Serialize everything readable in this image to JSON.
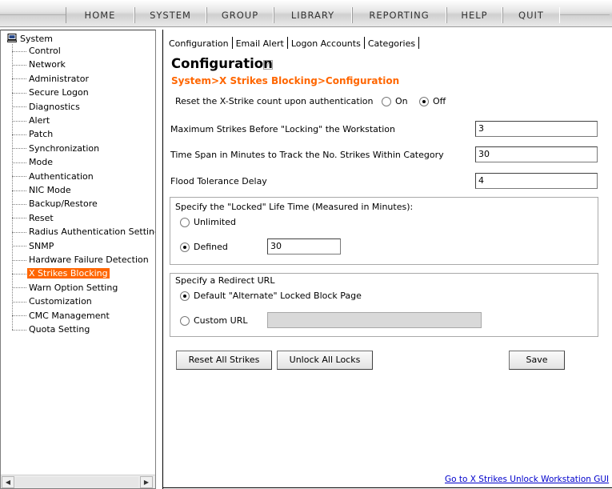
{
  "topnav": {
    "items": [
      "HOME",
      "SYSTEM",
      "GROUP",
      "LIBRARY",
      "REPORTING",
      "HELP",
      "QUIT"
    ]
  },
  "tree": {
    "root_label": "System",
    "root_icon": "computer-icon",
    "items": [
      "Control",
      "Network",
      "Administrator",
      "Secure Logon",
      "Diagnostics",
      "Alert",
      "Patch",
      "Synchronization",
      "Mode",
      "Authentication",
      "NIC Mode",
      "Backup/Restore",
      "Reset",
      "Radius Authentication Setting",
      "SNMP",
      "Hardware Failure Detection",
      "X Strikes Blocking",
      "Warn Option Setting",
      "Customization",
      "CMC Management",
      "Quota Setting"
    ],
    "selected_item": "X Strikes Blocking",
    "selected_color": "#ff6600"
  },
  "scrollbar": {
    "left_arrow": "◀",
    "right_arrow": "▶"
  },
  "tabs": [
    "Configuration",
    "Email Alert",
    "Logon Accounts",
    "Categories"
  ],
  "page": {
    "title": "Configuration",
    "help_icon": "help-icon",
    "breadcrumb": "System>X Strikes Blocking>Configuration",
    "breadcrumb_color": "#ff6600"
  },
  "reset_on_auth": {
    "label": "Reset the X-Strike count upon authentication",
    "on_label": "On",
    "off_label": "Off",
    "selected": "Off"
  },
  "fields": {
    "max_strikes": {
      "label": "Maximum Strikes Before \"Locking\" the Workstation",
      "value": "3"
    },
    "time_span": {
      "label": "Time Span in Minutes to Track the No. Strikes Within Category",
      "value": "30"
    },
    "flood_tolerance": {
      "label": "Flood Tolerance Delay",
      "value": "4"
    }
  },
  "locked_lifetime": {
    "legend": "Specify the \"Locked\" Life Time (Measured in Minutes):",
    "unlimited_label": "Unlimited",
    "defined_label": "Defined",
    "selected": "Defined",
    "defined_value": "30"
  },
  "redirect": {
    "legend": "Specify a Redirect URL",
    "default_label": "Default \"Alternate\" Locked Block Page",
    "custom_label": "Custom URL",
    "selected": "Default",
    "custom_value": ""
  },
  "buttons": {
    "reset_all": "Reset All Strikes",
    "unlock_all": "Unlock All Locks",
    "save": "Save"
  },
  "footer": {
    "link": "Go to X Strikes Unlock Workstation GUI"
  }
}
